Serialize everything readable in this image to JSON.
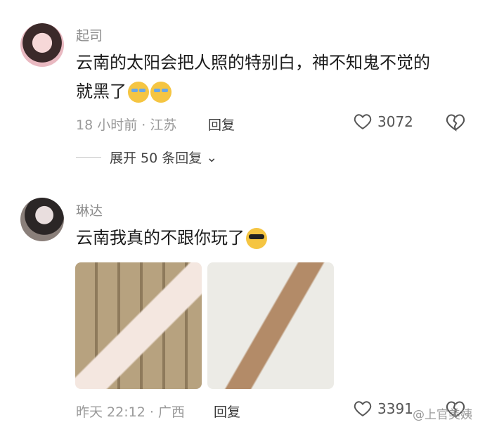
{
  "comments": [
    {
      "username": "起司",
      "text_line1": "云南的太阳会把人照的特别白，神不知鬼不觉的",
      "text_line2": "就黑了",
      "emojis": [
        "crying-face-icon",
        "crying-face-icon"
      ],
      "meta": "18 小时前 · 江苏",
      "reply_label": "回复",
      "likes": "3072",
      "expand_label": "展开 50 条回复"
    },
    {
      "username": "琳达",
      "text": "云南我真的不跟你玩了",
      "emojis": [
        "sunglasses-face-icon"
      ],
      "meta": "昨天 22:12 · 广西",
      "reply_label": "回复",
      "likes": "3391"
    }
  ],
  "watermark": "@上官美姨"
}
